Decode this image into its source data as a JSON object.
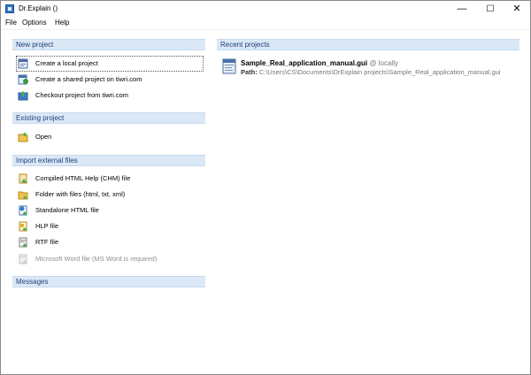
{
  "window": {
    "title": "Dr.Explain ()",
    "min_symbol": "—",
    "max_symbol": "☐",
    "close_symbol": "✕"
  },
  "menu": [
    "File",
    "Options",
    "Help"
  ],
  "new_project": {
    "header": "New project",
    "items": [
      {
        "label": "Create a local project",
        "icon": "local-project-icon"
      },
      {
        "label": "Create a shared project on tiwri.com",
        "icon": "shared-project-icon"
      },
      {
        "label": "Checkout project from tiwri.com",
        "icon": "checkout-project-icon"
      }
    ]
  },
  "existing_project": {
    "header": "Existing project",
    "items": [
      {
        "label": "Open",
        "icon": "open-folder-icon"
      }
    ]
  },
  "import": {
    "header": "Import external files",
    "items": [
      {
        "label": "Compiled HTML Help (CHM) file",
        "icon": "chm-file-icon"
      },
      {
        "label": "Folder with files (html, txt, xml)",
        "icon": "folder-files-icon"
      },
      {
        "label": "Standalone HTML file",
        "icon": "html-file-icon"
      },
      {
        "label": "HLP file",
        "icon": "hlp-file-icon"
      },
      {
        "label": "RTF file",
        "icon": "rtf-file-icon"
      },
      {
        "label": "Microsoft Word file (MS Word is required)",
        "icon": "word-file-icon",
        "disabled": true
      }
    ]
  },
  "messages": {
    "header": "Messages"
  },
  "recent": {
    "header": "Recent projects",
    "items": [
      {
        "name": "Sample_Real_application_manual.gui",
        "location": "@ locally",
        "path_label": "Path:",
        "path": "C:\\Users\\CS\\Documents\\DrExplain projects\\Sample_Real_application_manual.gui",
        "icon": "project-file-icon"
      }
    ]
  },
  "colors": {
    "header_bg": "#dbe8f6",
    "header_text": "#1f3f7a",
    "disabled_text": "#8f8f8f"
  }
}
